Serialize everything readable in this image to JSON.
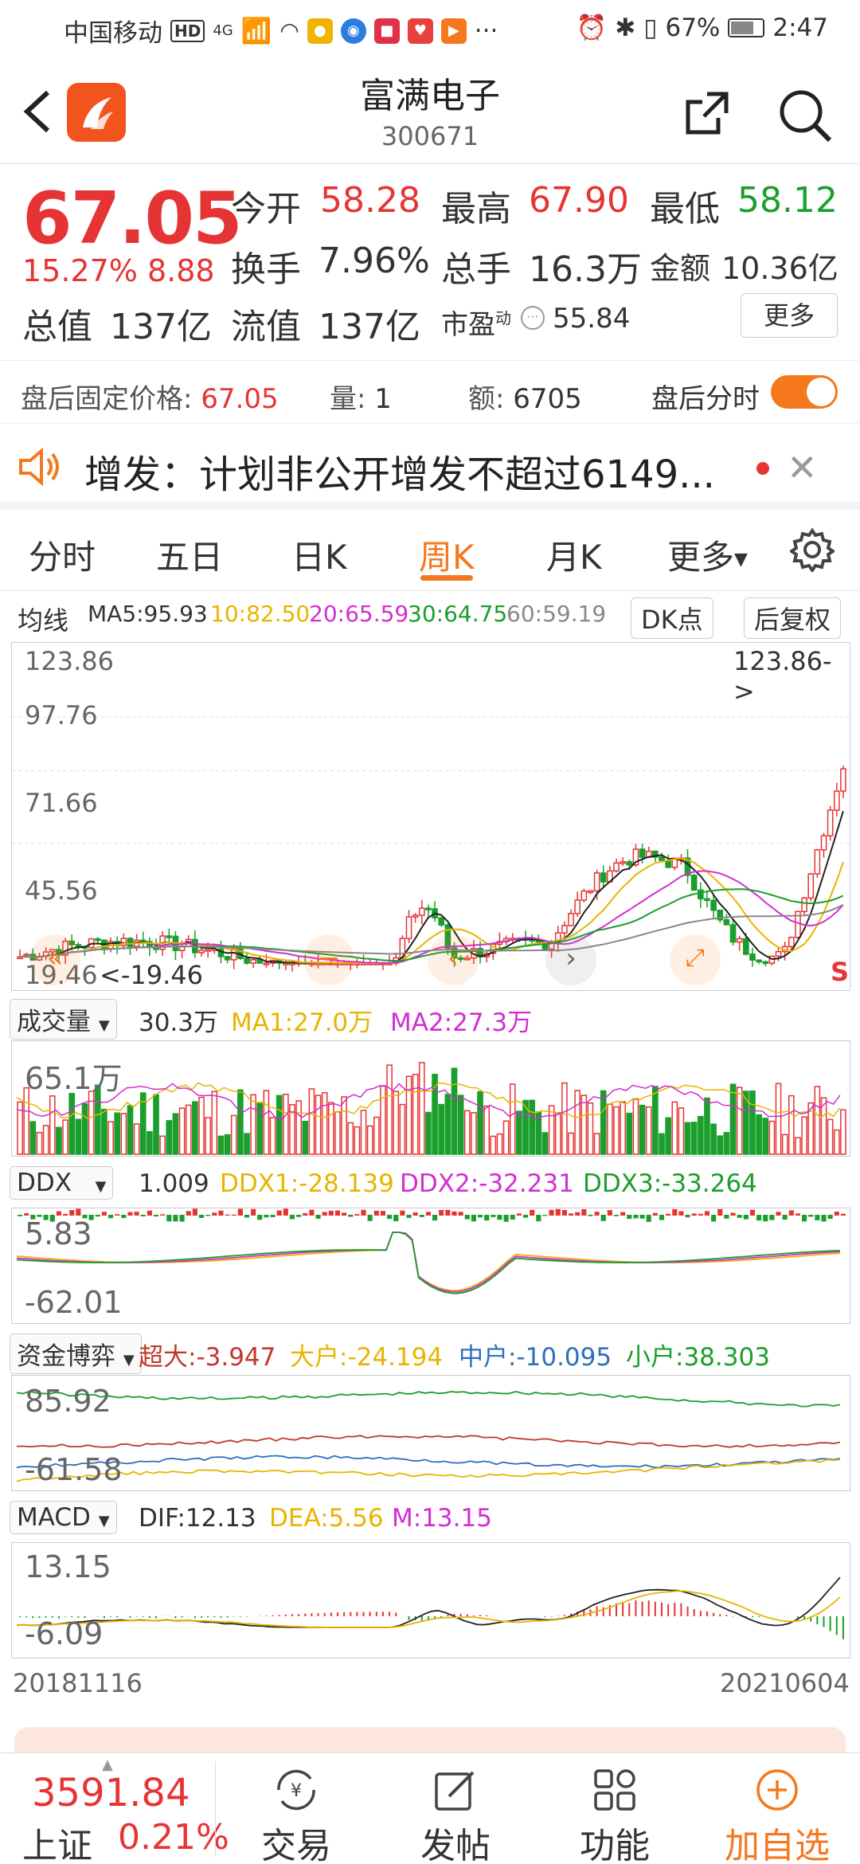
{
  "status_bar": {
    "carrier": "中国移动",
    "hd": "HD",
    "network": "4G",
    "battery": "67%",
    "time": "2:47"
  },
  "header": {
    "title": "富满电子",
    "code": "300671"
  },
  "quote": {
    "price": "67.05",
    "change_pct": "15.27%",
    "change": "8.88",
    "open_label": "今开",
    "open": "58.28",
    "high_label": "最高",
    "high": "67.90",
    "low_label": "最低",
    "low": "58.12",
    "turnover_label": "换手",
    "turnover": "7.96%",
    "volume_label": "总手",
    "volume": "16.3万",
    "amount_label": "金额",
    "amount": "10.36亿",
    "mktcap_label": "总值",
    "mktcap": "137亿",
    "float_label": "流值",
    "float_cap": "137亿",
    "pe_label": "市盈",
    "pe_sup": "动",
    "pe": "55.84",
    "more_label": "更多"
  },
  "after_hours": {
    "price_label": "盘后固定价格:",
    "price": "67.05",
    "qty_label": "量:",
    "qty": "1",
    "amt_label": "额:",
    "amt": "6705",
    "toggle_label": "盘后分时"
  },
  "notice": {
    "text": "增发：计划非公开增发不超过6149..."
  },
  "tabs": [
    "分时",
    "五日",
    "日K",
    "周K",
    "月K",
    "更多"
  ],
  "ma_row": {
    "label": "均线",
    "ma5": "MA5:95.93",
    "ma10": "10:82.50",
    "ma20": "20:65.59",
    "ma30": "30:64.75",
    "ma60": "60:59.19",
    "dk_btn": "DK点",
    "adj_btn": "后复权"
  },
  "kline": {
    "max_label": "123.86",
    "max_arrow": "123.86->",
    "y_labels": [
      "123.86",
      "97.76",
      "71.66",
      "45.56",
      "19.46"
    ],
    "min_arrow": "<-19.46",
    "s_marker": "S"
  },
  "volume_row": {
    "name": "成交量",
    "value": "30.3万",
    "ma1": "MA1:27.0万",
    "ma2": "MA2:27.3万",
    "y_label": "65.1万"
  },
  "ddx_row": {
    "name": "DDX",
    "value": "1.009",
    "ddx1": "DDX1:-28.139",
    "ddx2": "DDX2:-32.231",
    "ddx3": "DDX3:-33.264",
    "y_top": "5.83",
    "y_bottom": "-62.01"
  },
  "fund_row": {
    "name": "资金博弈",
    "super": "超大:-3.947",
    "big": "大户:-24.194",
    "mid": "中户:-10.095",
    "small": "小户:38.303",
    "y_top": "85.92",
    "y_bottom": "-61.58"
  },
  "macd_row": {
    "name": "MACD",
    "dif": "DIF:12.13",
    "dea": "DEA:5.56",
    "m": "M:13.15",
    "y_top": "13.15",
    "y_bottom": "-6.09"
  },
  "dates": {
    "start": "20181116",
    "end": "20210604"
  },
  "bottom": {
    "index_value": "3591.84",
    "index_name": "上证",
    "index_pct": "0.21%",
    "nav": [
      "交易",
      "发帖",
      "功能",
      "加自选"
    ]
  },
  "colors": {
    "up": "#e63434",
    "down": "#1a9e2c",
    "accent": "#f5781e",
    "ma10": "#e8b400",
    "ma20": "#d12fd1",
    "ma30": "#1a9e2c",
    "ma60": "#888888"
  }
}
